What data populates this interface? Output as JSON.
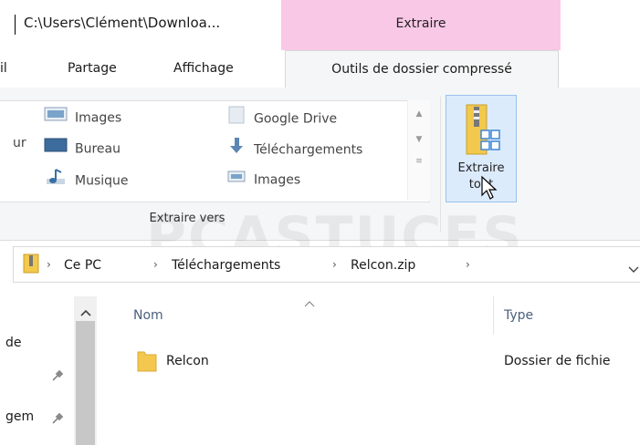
{
  "window": {
    "title": "C:\\Users\\Clément\\Downloa...",
    "context_tab_header": "Extraire"
  },
  "tabs": [
    {
      "label": "il"
    },
    {
      "label": "Partage"
    },
    {
      "label": "Affichage"
    },
    {
      "label": "Outils de dossier compressé"
    }
  ],
  "ribbon": {
    "extract_to": {
      "cut_left_label": "ur",
      "items": [
        {
          "label": "Images",
          "icon": "images-folder-icon"
        },
        {
          "label": "Bureau",
          "icon": "desktop-folder-icon"
        },
        {
          "label": "Musique",
          "icon": "music-folder-icon"
        },
        {
          "label": "Google Drive",
          "icon": "google-drive-folder-icon"
        },
        {
          "label": "Téléchargements",
          "icon": "downloads-folder-icon"
        },
        {
          "label": "Images",
          "icon": "images-folder-icon"
        }
      ],
      "group_label": "Extraire vers"
    },
    "extract_all": {
      "line1": "Extraire",
      "line2": "tout"
    }
  },
  "address": {
    "crumbs": [
      "Ce PC",
      "Téléchargements",
      "Relcon.zip"
    ]
  },
  "nav": {
    "items": [
      {
        "label": "de"
      },
      {
        "label": "gem"
      }
    ]
  },
  "files": {
    "columns": {
      "name": "Nom",
      "type": "Type"
    },
    "rows": [
      {
        "name": "Relcon",
        "type": "Dossier de fichie"
      }
    ]
  },
  "watermark": "PCASTUCES"
}
